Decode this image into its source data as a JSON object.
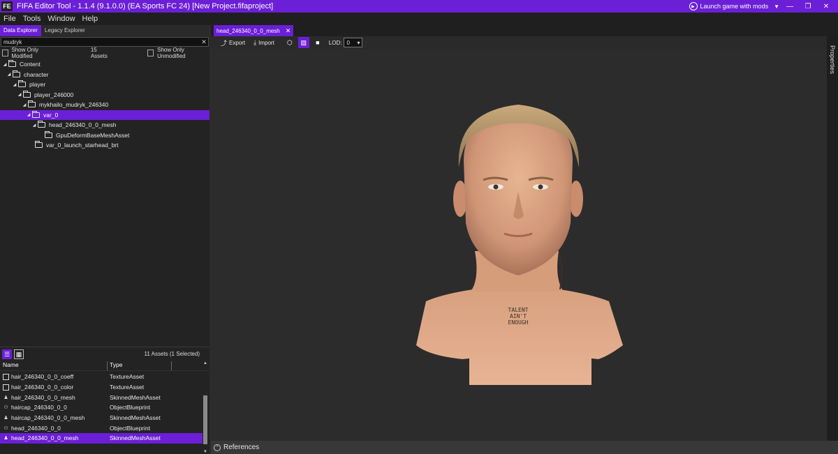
{
  "titlebar": {
    "logo": "FE",
    "title": "FIFA Editor Tool - 1.1.4 (9.1.0.0) (EA Sports FC 24) [New Project.fifaproject]",
    "launch_label": "Launch game with mods",
    "accent": "#6b1fd6"
  },
  "menu": [
    "File",
    "Tools",
    "Window",
    "Help"
  ],
  "left": {
    "tabs": [
      "Data Explorer",
      "Legacy Explorer"
    ],
    "search_value": "mudryk",
    "show_only_modified": "Show Only Modified",
    "asset_count": "15 Assets",
    "show_only_unmodified": "Show Only Unmodified",
    "tree": [
      {
        "label": "Content"
      },
      {
        "label": "character"
      },
      {
        "label": "player"
      },
      {
        "label": "player_246000"
      },
      {
        "label": "mykhailo_mudryk_246340"
      },
      {
        "label": "var_0"
      },
      {
        "label": "head_246340_0_0_mesh"
      },
      {
        "label": "GpuDeformBaseMeshAsset"
      },
      {
        "label": "var_0_launch_starhead_brt"
      }
    ]
  },
  "assets": {
    "count_label": "11 Assets (1 Selected)",
    "col_name": "Name",
    "col_type": "Type",
    "rows": [
      {
        "name": "hair_246340_0_0_coeff",
        "type": "TextureAsset",
        "icon": "texture-icon"
      },
      {
        "name": "hair_246340_0_0_color",
        "type": "TextureAsset",
        "icon": "texture-icon"
      },
      {
        "name": "hair_246340_0_0_mesh",
        "type": "SkinnedMeshAsset",
        "icon": "mesh-icon"
      },
      {
        "name": "haircap_246340_0_0",
        "type": "ObjectBlueprint",
        "icon": "blueprint-icon"
      },
      {
        "name": "haircap_246340_0_0_mesh",
        "type": "SkinnedMeshAsset",
        "icon": "mesh-icon"
      },
      {
        "name": "head_246340_0_0",
        "type": "ObjectBlueprint",
        "icon": "blueprint-icon"
      },
      {
        "name": "head_246340_0_0_mesh",
        "type": "SkinnedMeshAsset",
        "icon": "mesh-icon"
      }
    ]
  },
  "document": {
    "tab_label": "head_246340_0_0_mesh",
    "export_label": "Export",
    "import_label": "Import",
    "lod_label": "LOD:",
    "lod_value": "0",
    "properties_label": "Properties",
    "references_label": "References"
  },
  "viewport": {
    "tattoo_lines": [
      "TALENT",
      "AIN'T",
      "ENOUGH"
    ]
  }
}
